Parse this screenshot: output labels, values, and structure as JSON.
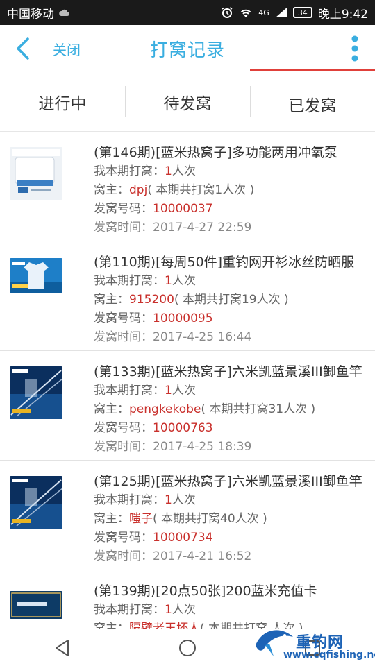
{
  "status_bar": {
    "carrier": "中国移动",
    "network": "4G",
    "battery": "34",
    "time": "晚上9:42"
  },
  "header": {
    "back_icon": "chevron-left-icon",
    "close_label": "关闭",
    "title": "打窝记录",
    "more_icon": "vertical-dots-icon",
    "accent_color": "#3aaee0"
  },
  "tabs": [
    {
      "label": "进行中",
      "active": false
    },
    {
      "label": "待发窝",
      "active": false
    },
    {
      "label": "已发窝",
      "active": true
    }
  ],
  "field_labels": {
    "my_bets": "我本期打窝：",
    "owner": "窝主：",
    "number": "发窝号码：",
    "time": "发窝时间："
  },
  "items": [
    {
      "title": "(第146期)[蓝米热窝子]多功能两用冲氧泵",
      "my_count": "1",
      "count_unit": "人次",
      "owner": "dpj",
      "owner_total": "( 本期共打窝1人次 )",
      "number": "10000037",
      "time": "2017-4-27 22:59"
    },
    {
      "title": "(第110期)[每周50件]重钓网开衫冰丝防晒服",
      "my_count": "1",
      "count_unit": "人次",
      "owner": "915200",
      "owner_total": "( 本期共打窝19人次 )",
      "number": "10000095",
      "time": "2017-4-25 16:44"
    },
    {
      "title": "(第133期)[蓝米热窝子]六米凯蓝景溪III鲫鱼竿",
      "my_count": "1",
      "count_unit": "人次",
      "owner": "pengkekobe",
      "owner_total": "( 本期共打窝31人次 )",
      "number": "10000763",
      "time": "2017-4-25 18:39"
    },
    {
      "title": "(第125期)[蓝米热窝子]六米凯蓝景溪III鲫鱼竿",
      "my_count": "1",
      "count_unit": "人次",
      "owner": "嗤子",
      "owner_total": "( 本期共打窝40人次 )",
      "number": "10000734",
      "time": "2017-4-21 16:52"
    },
    {
      "title": "(第139期)[20点50张]200蓝米充值卡",
      "my_count": "1",
      "count_unit": "人次",
      "owner": "隔壁老王坏人",
      "owner_total": "( 本期共打窝 人次 )"
    }
  ],
  "watermark": {
    "brand": "重钓网",
    "url": "www.cqfishing.net"
  }
}
